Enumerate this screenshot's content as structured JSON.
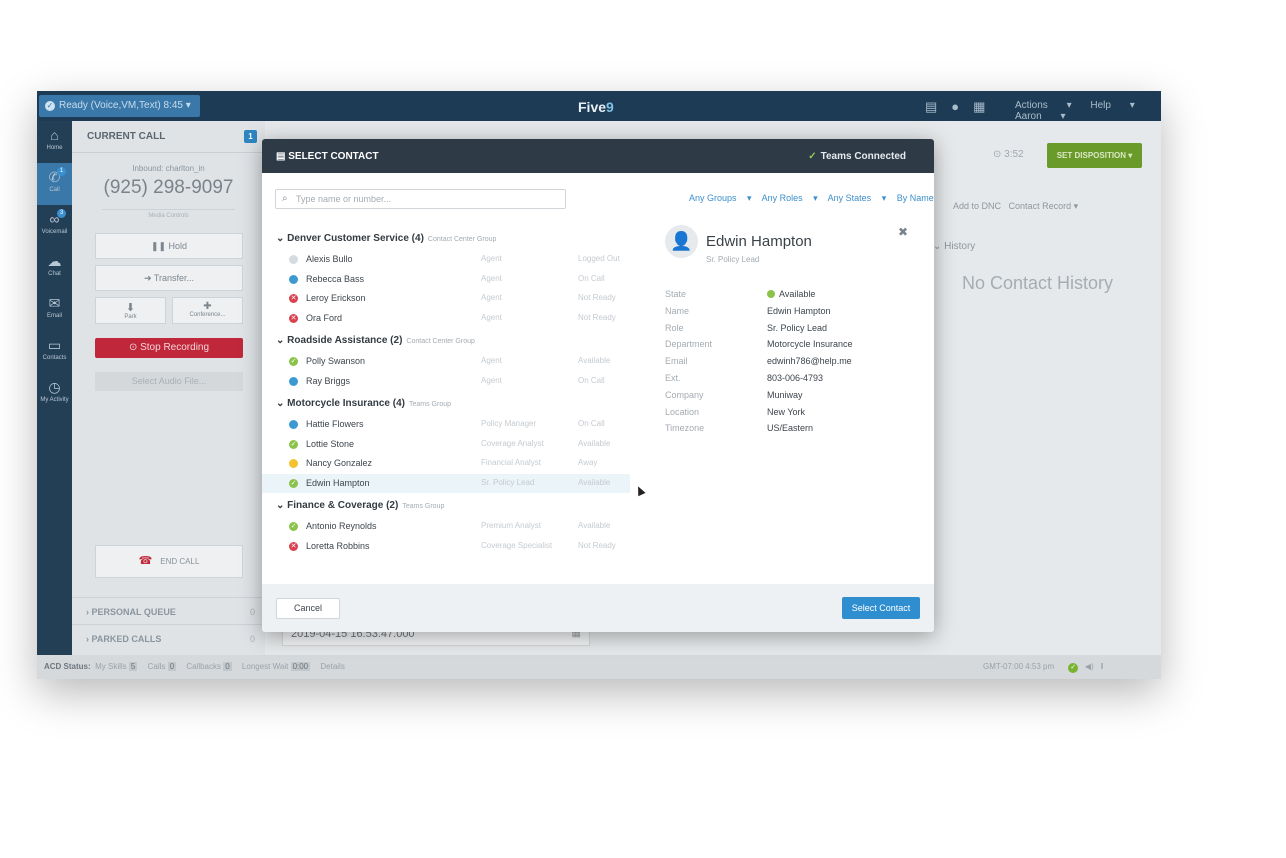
{
  "topbar": {
    "ready_label": "Ready  (Voice,VM,Text)   8:45",
    "logo_text": "Five",
    "logo_nine": "9",
    "menu": [
      "Actions",
      "Help",
      "Aaron"
    ]
  },
  "leftnav": [
    {
      "label": "Home",
      "icon": "home-icon",
      "glyph": "⌂"
    },
    {
      "label": "Call",
      "icon": "phone-icon",
      "glyph": "✆",
      "badge": "1"
    },
    {
      "label": "Voicemail",
      "icon": "voicemail-icon",
      "glyph": "∞",
      "badge": "3"
    },
    {
      "label": "Chat",
      "icon": "chat-icon",
      "glyph": "☁"
    },
    {
      "label": "Email",
      "icon": "email-icon",
      "glyph": "✉"
    },
    {
      "label": "Contacts",
      "icon": "folder-icon",
      "glyph": "▭"
    },
    {
      "label": "My Activity",
      "icon": "clock-icon",
      "glyph": "◷"
    }
  ],
  "call_panel": {
    "title": "CURRENT CALL",
    "count": "1",
    "inbound": "Inbound: charlton_in",
    "phone": "(925) 298-9097",
    "media_controls": "Media Controls",
    "hold": "Hold",
    "transfer": "Transfer...",
    "park": "Park",
    "conference": "Conference...",
    "stop_recording": "Stop Recording",
    "select_audio": "Select Audio File...",
    "end_call": "END CALL",
    "personal_queue": "PERSONAL QUEUE",
    "personal_queue_count": "0",
    "parked_calls": "PARKED CALLS",
    "parked_calls_count": "0"
  },
  "main": {
    "timer": "⊙ 3:52",
    "set_disposition": "SET DISPOSITION",
    "add_dnc": "Add to DNC",
    "contact_record": "Contact Record",
    "history": "History",
    "no_history": "No Contact History",
    "date": "2019-04-15 16:53:47.000"
  },
  "status_bar": {
    "acd": "ACD Status:",
    "my_skills": "My Skills",
    "my_skills_val": "5",
    "calls": "Calls",
    "calls_val": "0",
    "callbacks": "Callbacks",
    "callbacks_val": "0",
    "longest_wait": "Longest Wait",
    "longest_wait_val": "0:00",
    "details": "Details",
    "clock": "GMT-07:00 4:53 pm"
  },
  "modal": {
    "title": "SELECT CONTACT",
    "teams_connected": "Teams Connected",
    "search_placeholder": "Type name or number...",
    "filters": [
      "Any Groups",
      "Any Roles",
      "Any States",
      "By Name"
    ],
    "groups": [
      {
        "name": "Denver Customer Service (4)",
        "type": "Contact Center Group",
        "members": [
          {
            "name": "Alexis Bullo",
            "role": "Agent",
            "state": "Logged Out",
            "status": "logged-out"
          },
          {
            "name": "Rebecca Bass",
            "role": "Agent",
            "state": "On Call",
            "status": "on-call"
          },
          {
            "name": "Leroy Erickson",
            "role": "Agent",
            "state": "Not Ready",
            "status": "not-ready"
          },
          {
            "name": "Ora Ford",
            "role": "Agent",
            "state": "Not Ready",
            "status": "not-ready"
          }
        ]
      },
      {
        "name": "Roadside Assistance (2)",
        "type": "Contact Center Group",
        "members": [
          {
            "name": "Polly Swanson",
            "role": "Agent",
            "state": "Available",
            "status": "available"
          },
          {
            "name": "Ray Briggs",
            "role": "Agent",
            "state": "On Call",
            "status": "on-call"
          }
        ]
      },
      {
        "name": "Motorcycle Insurance (4)",
        "type": "Teams Group",
        "members": [
          {
            "name": "Hattie Flowers",
            "role": "Policy Manager",
            "state": "On Call",
            "status": "on-call"
          },
          {
            "name": "Lottie Stone",
            "role": "Coverage Analyst",
            "state": "Available",
            "status": "available"
          },
          {
            "name": "Nancy Gonzalez",
            "role": "Financial Analyst",
            "state": "Away",
            "status": "away"
          },
          {
            "name": "Edwin Hampton",
            "role": "Sr. Policy Lead",
            "state": "Available",
            "status": "available",
            "selected": true
          }
        ]
      },
      {
        "name": "Finance & Coverage (2)",
        "type": "Teams Group",
        "members": [
          {
            "name": "Antonio Reynolds",
            "role": "Premium Analyst",
            "state": "Available",
            "status": "available"
          },
          {
            "name": "Loretta Robbins",
            "role": "Coverage Specialist",
            "state": "Not Ready",
            "status": "not-ready"
          }
        ]
      }
    ],
    "detail": {
      "name": "Edwin Hampton",
      "role": "Sr. Policy Lead",
      "fields": [
        {
          "key": "State",
          "value": "Available"
        },
        {
          "key": "Name",
          "value": "Edwin Hampton"
        },
        {
          "key": "Role",
          "value": "Sr. Policy Lead"
        },
        {
          "key": "Department",
          "value": "Motorcycle Insurance"
        },
        {
          "key": "Email",
          "value": "edwinh786@help.me"
        },
        {
          "key": "Ext.",
          "value": "803-006-4793"
        },
        {
          "key": "Company",
          "value": "Muniway"
        },
        {
          "key": "Location",
          "value": "New York"
        },
        {
          "key": "Timezone",
          "value": "US/Eastern"
        }
      ]
    },
    "cancel": "Cancel",
    "select_contact": "Select Contact"
  },
  "colors": {
    "available": "#8bc34a",
    "on-call": "#3d9ad1",
    "not-ready": "#d9414e",
    "away": "#f2c230",
    "logged-out": "#d6dbdf"
  }
}
